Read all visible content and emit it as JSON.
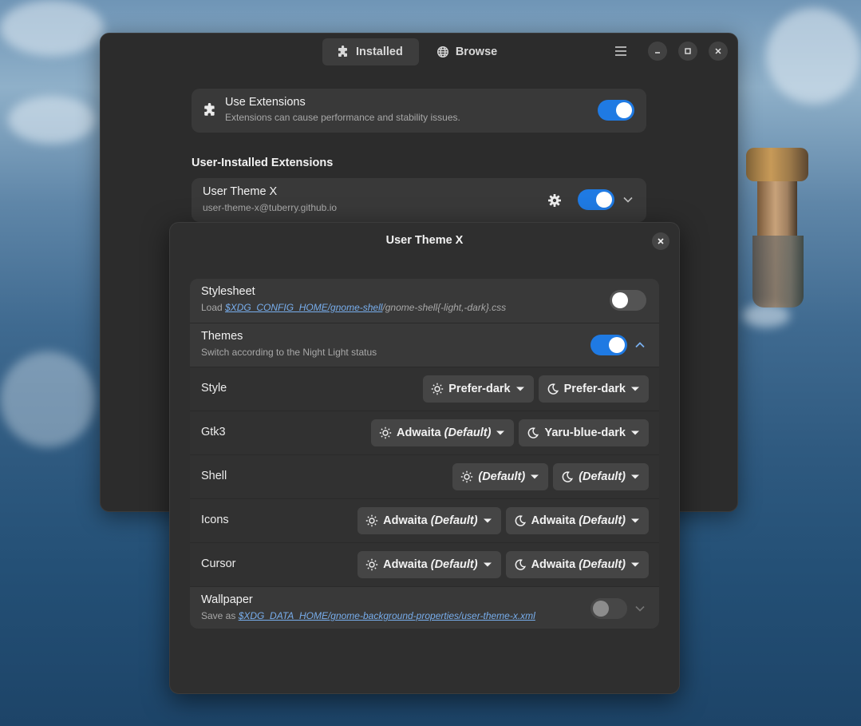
{
  "main_window": {
    "tabs": [
      {
        "label": "Installed",
        "icon": "puzzle-icon",
        "active": true
      },
      {
        "label": "Browse",
        "icon": "globe-icon",
        "active": false
      }
    ],
    "use_extensions": {
      "title": "Use Extensions",
      "subtitle": "Extensions can cause performance and stability issues.",
      "enabled": true
    },
    "section_title": "User-Installed Extensions",
    "extension": {
      "name": "User Theme X",
      "uuid": "user-theme-x@tuberry.github.io",
      "enabled": true
    }
  },
  "dialog": {
    "title": "User Theme X",
    "stylesheet": {
      "title": "Stylesheet",
      "sub_prefix": "Load ",
      "sub_link": "$XDG_CONFIG_HOME/gnome-shell",
      "sub_suffix": "/gnome-shell{-light,-dark}.css",
      "enabled": false
    },
    "themes": {
      "title": "Themes",
      "subtitle": "Switch according to the Night Light status",
      "enabled": true
    },
    "rows": [
      {
        "label": "Style",
        "light": {
          "name": "Prefer-dark",
          "suffix": ""
        },
        "dark": {
          "name": "Prefer-dark",
          "suffix": ""
        }
      },
      {
        "label": "Gtk3",
        "light": {
          "name": "Adwaita",
          "suffix": "(Default)"
        },
        "dark": {
          "name": "Yaru-blue-dark",
          "suffix": ""
        }
      },
      {
        "label": "Shell",
        "light": {
          "name": "",
          "suffix": "(Default)"
        },
        "dark": {
          "name": "",
          "suffix": "(Default)"
        }
      },
      {
        "label": "Icons",
        "light": {
          "name": "Adwaita",
          "suffix": "(Default)"
        },
        "dark": {
          "name": "Adwaita",
          "suffix": "(Default)"
        }
      },
      {
        "label": "Cursor",
        "light": {
          "name": "Adwaita",
          "suffix": "(Default)"
        },
        "dark": {
          "name": "Adwaita",
          "suffix": "(Default)"
        }
      }
    ],
    "wallpaper": {
      "title": "Wallpaper",
      "sub_prefix": "Save as ",
      "sub_link": "$XDG_DATA_HOME/gnome-background-properties/user-theme-x.xml",
      "enabled": false
    }
  },
  "colors": {
    "accent": "#1f7ae3",
    "link": "#78aeed"
  }
}
